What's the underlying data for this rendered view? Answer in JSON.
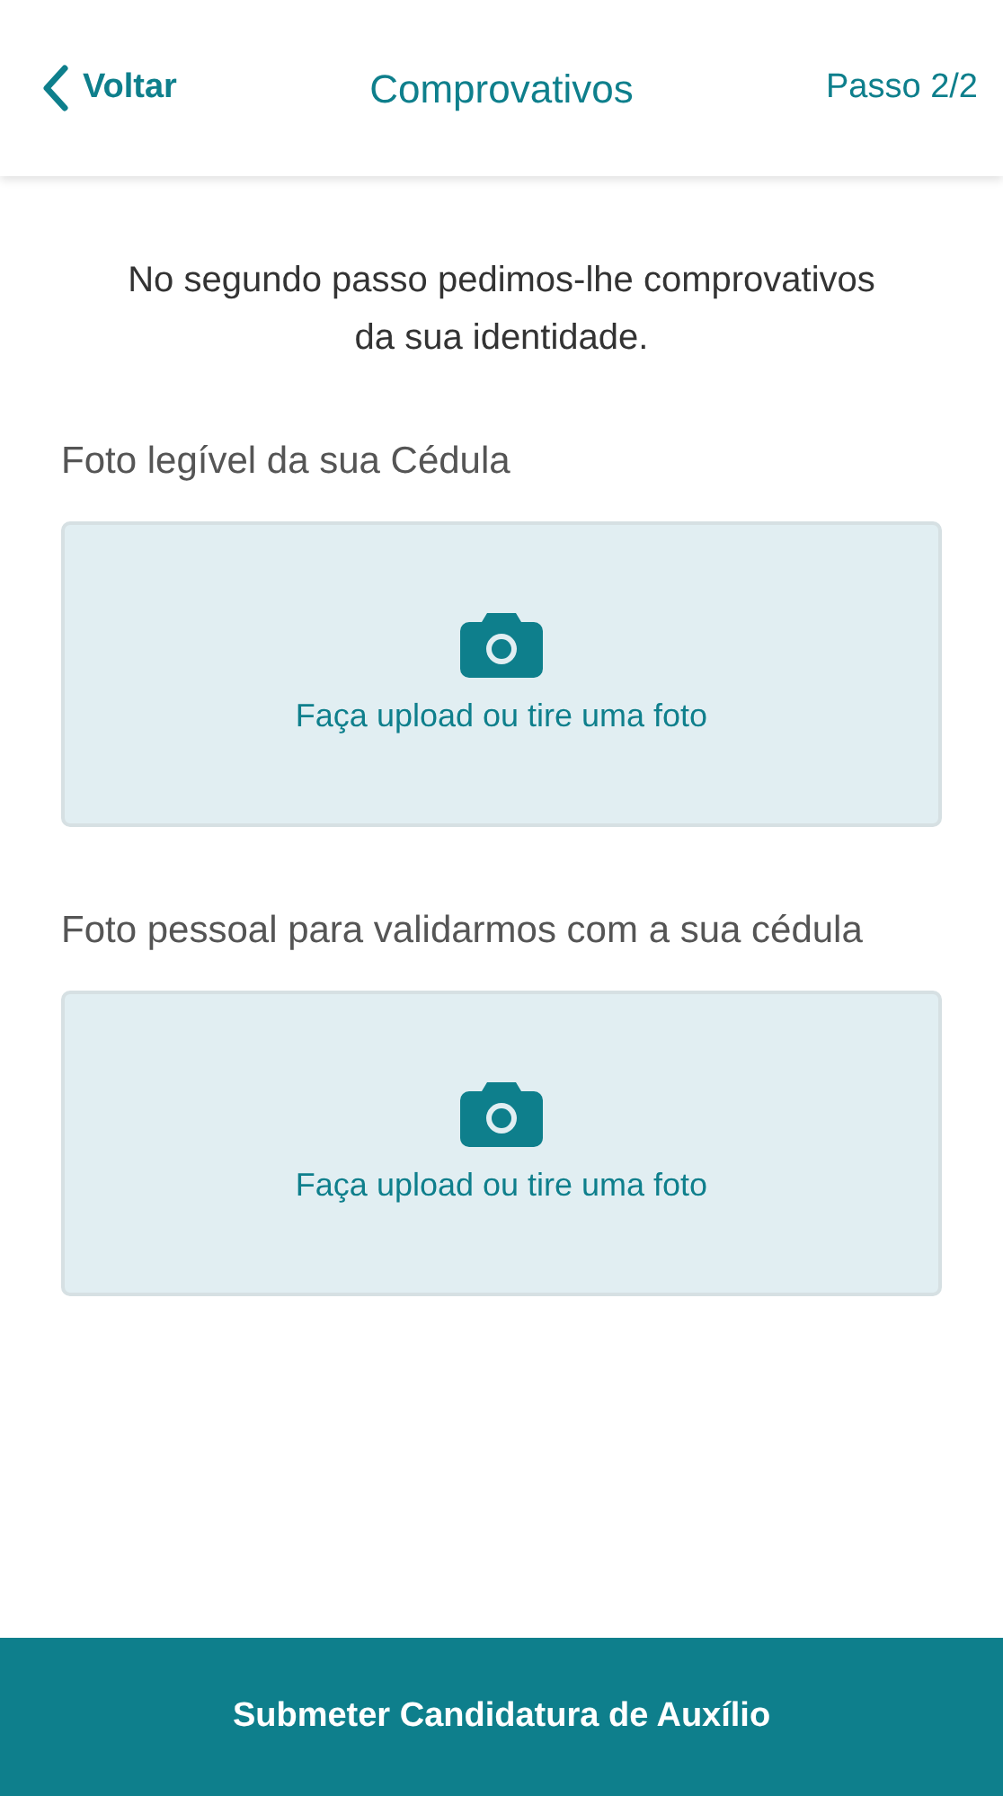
{
  "header": {
    "back_label": "Voltar",
    "title": "Comprovativos",
    "step": "Passo 2/2"
  },
  "intro": "No segundo passo pedimos-lhe comprovativos da sua identidade.",
  "uploads": [
    {
      "label": "Foto legível da sua Cédula",
      "prompt": "Faça upload ou tire uma foto"
    },
    {
      "label": "Foto pessoal para validarmos com a sua cédula",
      "prompt": "Faça upload ou tire uma foto"
    }
  ],
  "submit_button": "Submeter Candidatura de Auxílio"
}
